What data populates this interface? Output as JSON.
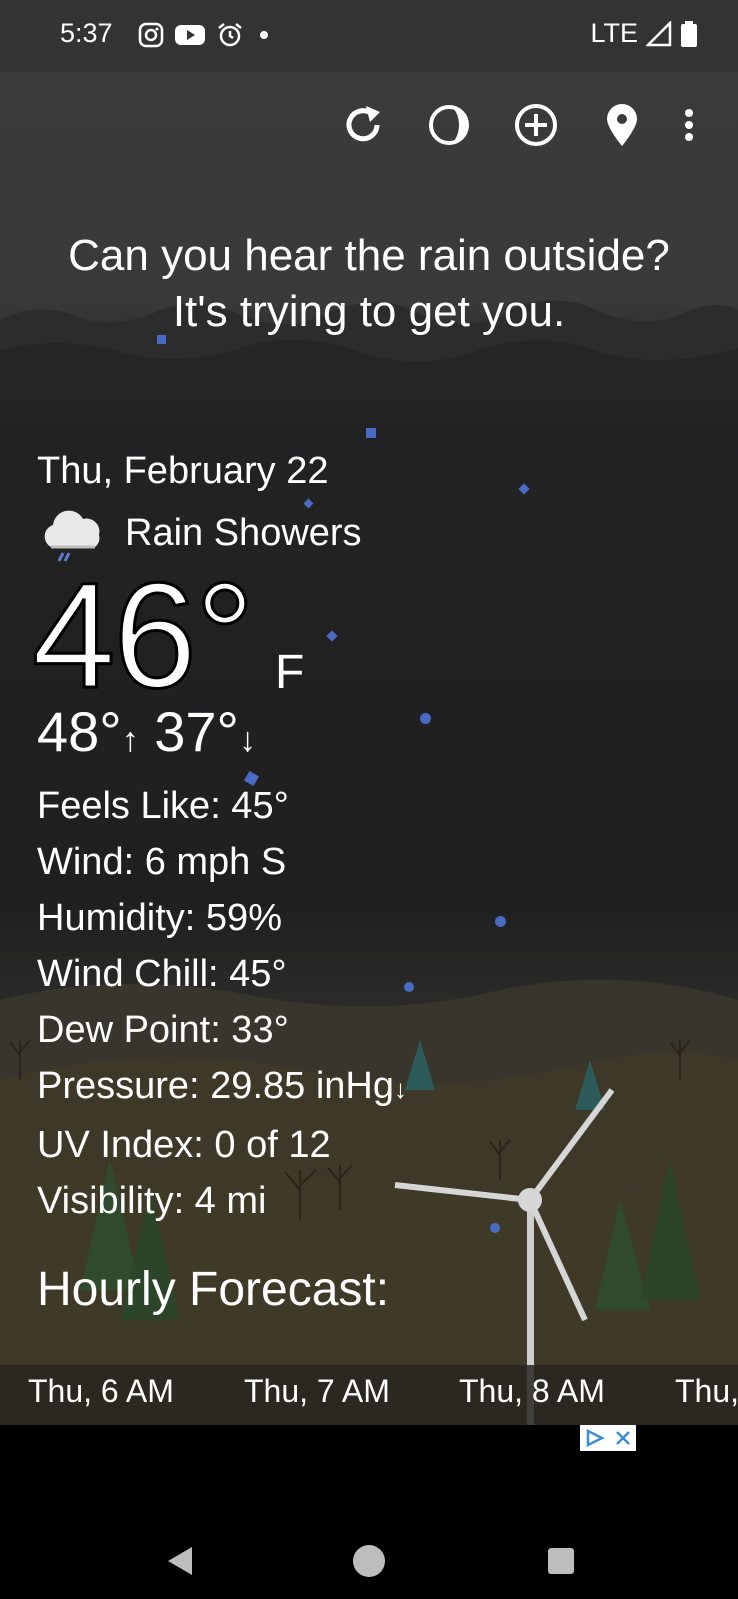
{
  "status_bar": {
    "time": "5:37",
    "network": "LTE",
    "icons": [
      "instagram-icon",
      "youtube-icon",
      "alarm-icon",
      "dot-icon",
      "signal-icon",
      "battery-icon"
    ]
  },
  "toolbar": {
    "icons": [
      "refresh-icon",
      "moon-phase-icon",
      "add-location-icon",
      "location-pin-icon",
      "more-options-icon"
    ]
  },
  "quote": {
    "line1": "Can you hear the rain outside?",
    "line2": "It's trying to get you."
  },
  "current": {
    "date": "Thu, February 22",
    "condition": "Rain Showers",
    "condition_icon": "rain-cloud-icon",
    "temperature": "46°",
    "unit": "F",
    "high": "48°",
    "low": "37°",
    "feels_like": "Feels Like:  45°",
    "wind": "Wind:  6 mph S",
    "humidity": "Humidity:  59%",
    "wind_chill": "Wind Chill:  45°",
    "dew_point": "Dew Point:  33°",
    "pressure": "Pressure:  29.85 inHg",
    "uv_index": "UV Index:  0 of 12",
    "visibility": "Visibility:  4 mi"
  },
  "hourly": {
    "title": "Hourly Forecast:",
    "hours": [
      "Thu, 6 AM",
      "Thu, 7 AM",
      "Thu, 8 AM",
      "Thu,"
    ]
  },
  "colors": {
    "background": "#1e1e1f",
    "status_bar": "#333334",
    "rain_drop": "#4a6bc4",
    "text": "#ffffff"
  }
}
